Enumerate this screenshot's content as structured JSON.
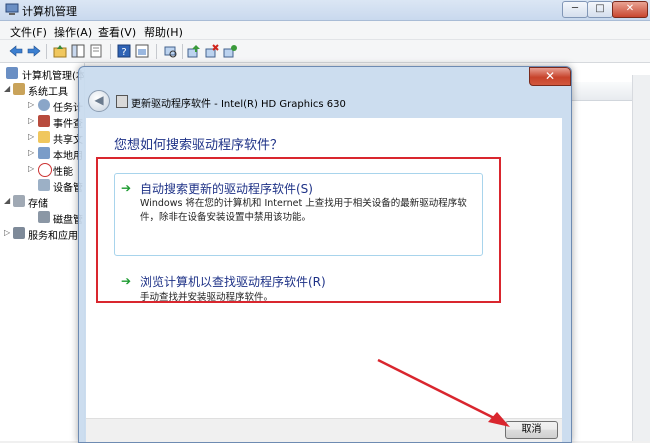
{
  "window": {
    "title": "计算机管理",
    "min_glyph": "─",
    "max_glyph": "□",
    "close_glyph": "✕"
  },
  "menu": [
    "文件(F)",
    "操作(A)",
    "查看(V)",
    "帮助(H)"
  ],
  "tree": [
    {
      "label": "计算机管理(本"
    },
    {
      "label": "系统工具"
    },
    {
      "label": "任务计"
    },
    {
      "label": "事件查"
    },
    {
      "label": "共享文"
    },
    {
      "label": "本地用"
    },
    {
      "label": "性能"
    },
    {
      "label": "设备管"
    },
    {
      "label": "存储"
    },
    {
      "label": "磁盘管"
    },
    {
      "label": "服务和应用"
    }
  ],
  "dialog": {
    "back_glyph": "◀",
    "close_glyph": "✕",
    "title": "更新驱动程序软件 - Intel(R) HD Graphics 630",
    "question": "您想如何搜索驱动程序软件？",
    "option_auto": {
      "arrow": "➔",
      "title": "自动搜索更新的驱动程序软件(S)",
      "desc": "Windows 将在您的计算机和 Internet 上查找用于相关设备的最新驱动程序软件，除非在设备安装设置中禁用该功能。"
    },
    "option_browse": {
      "arrow": "➔",
      "title": "浏览计算机以查找驱动程序软件(R)",
      "desc": "手动查找并安装驱动程序软件。"
    },
    "cancel_label": "取消"
  },
  "colors": {
    "highlight": "#d9262e",
    "link_blue": "#1e3287",
    "arrow_green": "#1d9b30"
  }
}
